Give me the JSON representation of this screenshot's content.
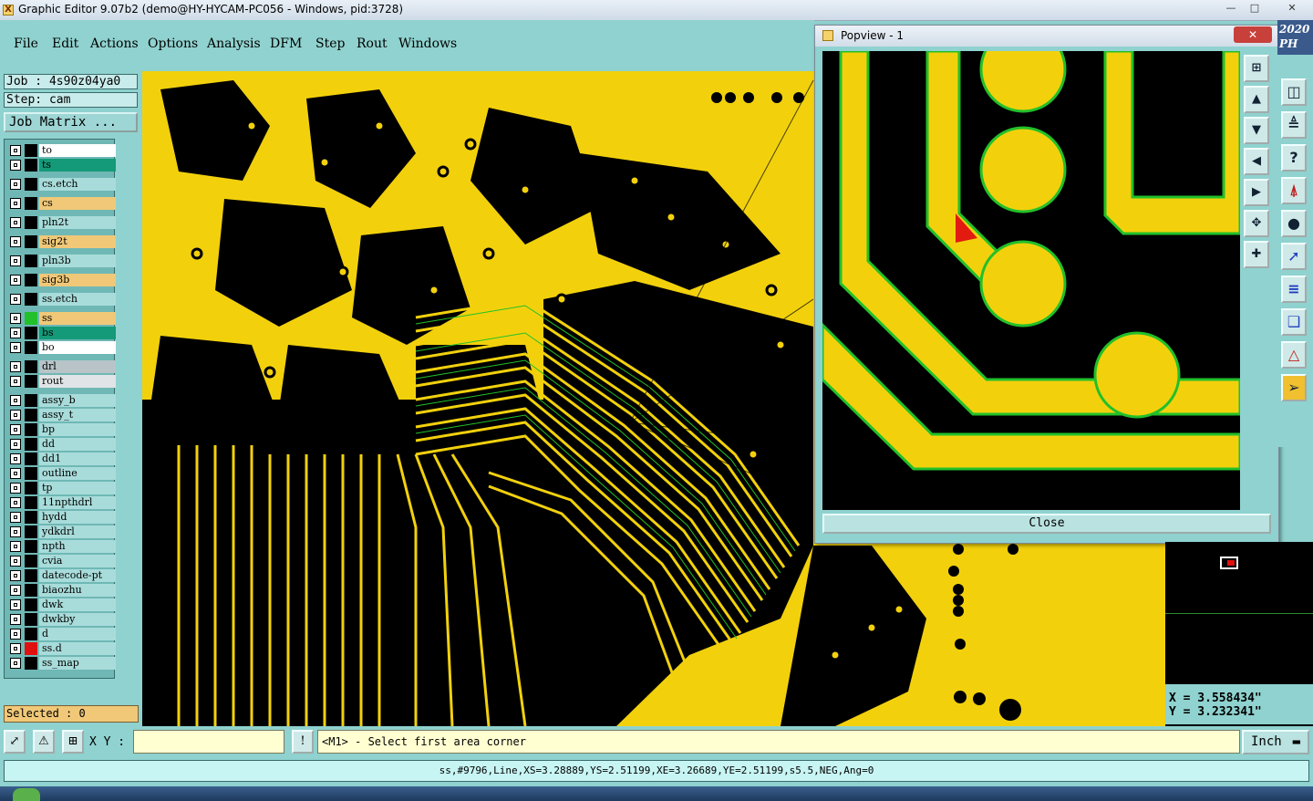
{
  "window": {
    "title": "Graphic Editor 9.07b2 (demo@HY-HYCAM-PC056 - Windows, pid:3728)",
    "app_icon": "X"
  },
  "menu": [
    "File",
    "Edit",
    "Actions",
    "Options",
    "Analysis",
    "DFM",
    "Step",
    "Rout",
    "Windows"
  ],
  "job": {
    "job_label": "Job : 4s90z04ya0",
    "step_label": "Step: cam",
    "matrix_button": "Job Matrix ..."
  },
  "layers": [
    {
      "name": "to",
      "color": "#ffffff",
      "swatch": "#000000"
    },
    {
      "name": "ts",
      "color": "#149a78",
      "swatch": "#000000"
    },
    {
      "name": "cs.etch",
      "color": "#a8dcda",
      "swatch": "#000000"
    },
    {
      "name": "cs",
      "color": "#f0c878",
      "swatch": "#000000"
    },
    {
      "name": "pln2t",
      "color": "#a8dcda",
      "swatch": "#000000"
    },
    {
      "name": "sig2t",
      "color": "#f0c878",
      "swatch": "#000000"
    },
    {
      "name": "pln3b",
      "color": "#a8dcda",
      "swatch": "#000000"
    },
    {
      "name": "sig3b",
      "color": "#f0c878",
      "swatch": "#000000"
    },
    {
      "name": "ss.etch",
      "color": "#a8dcda",
      "swatch": "#000000"
    },
    {
      "name": "ss",
      "color": "#f0c878",
      "swatch": "#22c02a"
    },
    {
      "name": "bs",
      "color": "#149a78",
      "swatch": "#000000"
    },
    {
      "name": "bo",
      "color": "#ffffff",
      "swatch": "#000000"
    },
    {
      "name": "drl",
      "color": "#b8c4c8",
      "swatch": "#000000"
    },
    {
      "name": "rout",
      "color": "#e0e4e6",
      "swatch": "#000000"
    },
    {
      "name": "assy_b",
      "color": "#a8dcda",
      "swatch": "#000000"
    },
    {
      "name": "assy_t",
      "color": "#a8dcda",
      "swatch": "#000000"
    },
    {
      "name": "bp",
      "color": "#a8dcda",
      "swatch": "#000000"
    },
    {
      "name": "dd",
      "color": "#a8dcda",
      "swatch": "#000000"
    },
    {
      "name": "dd1",
      "color": "#a8dcda",
      "swatch": "#000000"
    },
    {
      "name": "outline",
      "color": "#a8dcda",
      "swatch": "#000000"
    },
    {
      "name": "tp",
      "color": "#a8dcda",
      "swatch": "#000000"
    },
    {
      "name": "11npthdrl",
      "color": "#a8dcda",
      "swatch": "#000000"
    },
    {
      "name": "hydd",
      "color": "#a8dcda",
      "swatch": "#000000"
    },
    {
      "name": "ydkdrl",
      "color": "#a8dcda",
      "swatch": "#000000"
    },
    {
      "name": "npth",
      "color": "#a8dcda",
      "swatch": "#000000"
    },
    {
      "name": "cvia",
      "color": "#a8dcda",
      "swatch": "#000000"
    },
    {
      "name": "datecode-pt",
      "color": "#a8dcda",
      "swatch": "#000000"
    },
    {
      "name": "biaozhu",
      "color": "#a8dcda",
      "swatch": "#000000"
    },
    {
      "name": "dwk",
      "color": "#a8dcda",
      "swatch": "#000000"
    },
    {
      "name": "dwkby",
      "color": "#a8dcda",
      "swatch": "#000000"
    },
    {
      "name": "d",
      "color": "#a8dcda",
      "swatch": "#000000"
    },
    {
      "name": "ss.d",
      "color": "#a8dcda",
      "swatch": "#e01010"
    },
    {
      "name": "ss_map",
      "color": "#a8dcda",
      "swatch": "#000000"
    }
  ],
  "selected": "Selected : 0",
  "popview": {
    "title": "Popview - 1",
    "close_label": "Close"
  },
  "coords": {
    "x": "X = 3.558434\"",
    "y": "Y = 3.232341\""
  },
  "bottom": {
    "xy_label": "X Y :",
    "xy_value": "",
    "message": "<M1> - Select first area corner",
    "unit": "Inch"
  },
  "status": "ss,#9796,Line,XS=3.28889,YS=2.51199,XE=3.26689,YE=2.51199,s5.5,NEG,Ang=0",
  "banner": {
    "top": "2020",
    "bottom": "PH"
  },
  "colors": {
    "copper": "#f2d10c",
    "board": "#000000",
    "outline": "#22c02a",
    "ui": "#8fd2cf"
  }
}
